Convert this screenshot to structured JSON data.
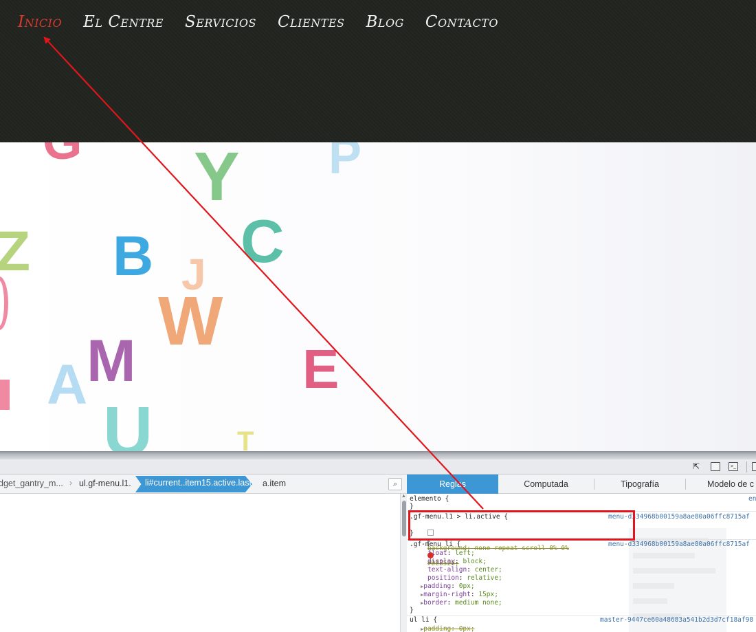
{
  "nav": {
    "items": [
      {
        "label": "Inicio",
        "active": true
      },
      {
        "label": "El Centre",
        "active": false
      },
      {
        "label": "Servicios",
        "active": false
      },
      {
        "label": "Clientes",
        "active": false
      },
      {
        "label": "Blog",
        "active": false
      },
      {
        "label": "Contacto",
        "active": false
      }
    ],
    "active_color": "#d9392c",
    "bg_color": "#22241f"
  },
  "hero": {
    "letters": [
      "G",
      "Y",
      "P",
      "Z",
      "B",
      "C",
      "J",
      "W",
      "M",
      "E",
      "A",
      "U",
      "T"
    ]
  },
  "devtools": {
    "breadcrumb": {
      "items": [
        "dget_gantry_m...",
        "ul.gf-menu.l1.",
        "li#current..item15.active.last",
        "a.item"
      ],
      "search_icon": "search-icon"
    },
    "tabs": [
      "Reglas",
      "Computada",
      "Tipografía",
      "Modelo de c"
    ],
    "rules": {
      "element": {
        "selector": "elemento {",
        "close": "}",
        "src": "en"
      },
      "active_rule": {
        "selector": ".gf-menu.l1 > li.active {",
        "src": "menu-d334968b00159a8ae80a06ffc8715af",
        "prop": "background: none repeat scroll 0% 0%",
        "color_value": "#DE3526;",
        "close": "}"
      },
      "menu_li": {
        "selector": ".gf-menu li {",
        "src": "menu-d334968b00159a8ae80a06ffc8715af",
        "props": [
          {
            "name": "float",
            "value": "left;"
          },
          {
            "name": "display",
            "value": "block;"
          },
          {
            "name": "text-align",
            "value": "center;"
          },
          {
            "name": "position",
            "value": "relative;"
          },
          {
            "name": "padding",
            "value": "0px;"
          },
          {
            "name": "margin-right",
            "value": "15px;"
          },
          {
            "name": "border",
            "value": "medium none;"
          }
        ],
        "close": "}"
      },
      "ul_li": {
        "selector": "ul li {",
        "src": "master-9447ce60a48683a541b2d3d7cf18af98",
        "prop": "padding: 0px;"
      }
    },
    "accent_color": "#3d97d4",
    "highlight_color": "#e0161c"
  }
}
